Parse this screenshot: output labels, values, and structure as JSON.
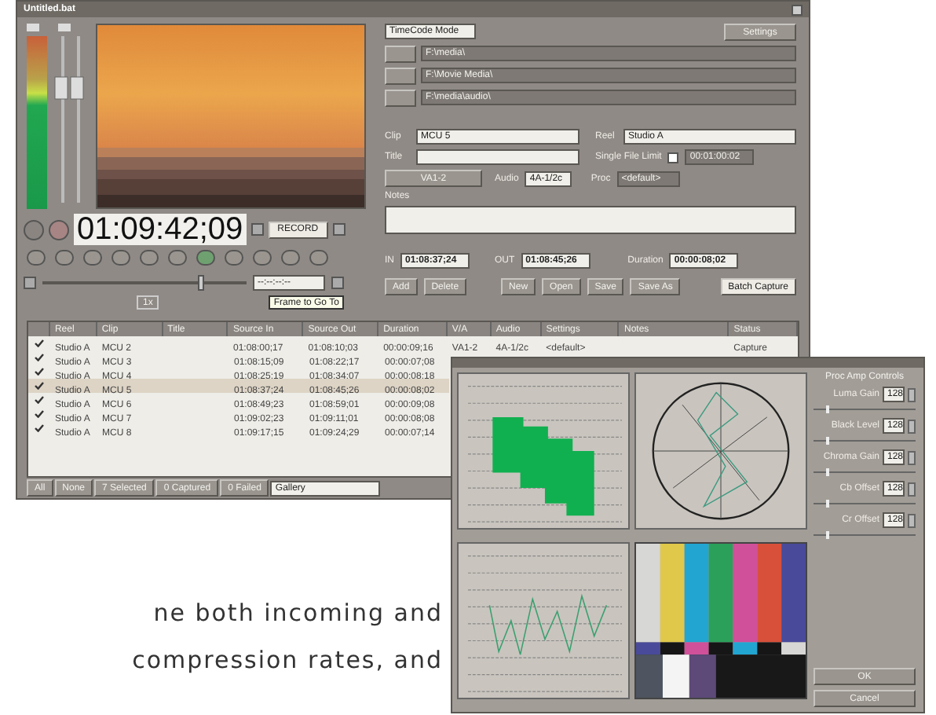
{
  "main_window": {
    "title": "Untitled.bat",
    "monitor": {
      "timecode": "01:09:42;09",
      "record_button": "RECORD",
      "frame_field": "--:--:--:--",
      "speed": "1x",
      "tooltip": "Frame to Go To",
      "shuttle": {
        "level": 0.78
      }
    },
    "mode_select": "TimeCode Mode",
    "settings_button": "Settings",
    "paths": [
      "F:\\media\\",
      "F:\\Movie Media\\",
      "F:\\media\\audio\\"
    ],
    "form": {
      "clip_label": "Clip",
      "clip": "MCU 5",
      "reel_label": "Reel",
      "reel": "Studio A",
      "title_label": "Title",
      "limit_label": "Single File Limit",
      "limit_checked": false,
      "limit": "00:01:00:02",
      "video_button": "VA1-2",
      "audio_label": "Audio",
      "audio": "4A-1/2c",
      "proc_label": "Proc",
      "proc": "<default>",
      "notes_label": "Notes"
    },
    "timecodes": {
      "in_label": "IN",
      "in": "01:08:37;24",
      "out_label": "OUT",
      "out": "01:08:45;26",
      "duration_label": "Duration",
      "duration": "00:00:08;02"
    },
    "buttons": [
      "Add",
      "Delete",
      "New",
      "Open",
      "Save",
      "Save As",
      "Batch Capture"
    ],
    "table": {
      "columns": [
        "Reel",
        "Clip",
        "Title",
        "Source In",
        "Source Out",
        "Duration",
        "V/A",
        "Audio",
        "Settings",
        "Notes",
        "Status"
      ],
      "rows": [
        {
          "checked": true,
          "selected": false,
          "cells": [
            "Studio A",
            "MCU 2",
            null,
            "01:08:00;17",
            "01:08:10;03",
            "00:00:09;16",
            "VA1-2",
            "4A-1/2c",
            "<default>",
            null,
            "Capture"
          ]
        },
        {
          "checked": true,
          "selected": false,
          "cells": [
            "Studio A",
            "MCU 3",
            null,
            "01:08:15;09",
            "01:08:22;17",
            "00:00:07;08"
          ]
        },
        {
          "checked": true,
          "selected": false,
          "cells": [
            "Studio A",
            "MCU 4",
            null,
            "01:08:25;19",
            "01:08:34;07",
            "00:00:08;18"
          ]
        },
        {
          "checked": true,
          "selected": true,
          "cells": [
            "Studio A",
            "MCU 5",
            null,
            "01:08:37;24",
            "01:08:45;26",
            "00:00:08;02"
          ]
        },
        {
          "checked": true,
          "selected": false,
          "cells": [
            "Studio A",
            "MCU 6",
            null,
            "01:08:49;23",
            "01:08:59;01",
            "00:00:09;08"
          ]
        },
        {
          "checked": true,
          "selected": false,
          "cells": [
            "Studio A",
            "MCU 7",
            null,
            "01:09:02;23",
            "01:09:11;01",
            "00:00:08;08"
          ]
        },
        {
          "checked": true,
          "selected": false,
          "cells": [
            "Studio A",
            "MCU 8",
            null,
            "01:09:17;15",
            "01:09:24;29",
            "00:00:07;14"
          ]
        }
      ]
    },
    "status_bar": {
      "buttons": [
        "All",
        "None",
        "7 Selected",
        "0 Captured",
        "0 Failed"
      ],
      "bin": "Gallery"
    }
  },
  "scope_window": {
    "proc_amp_title": "Proc Amp Controls",
    "controls": [
      {
        "label": "Luma Gain",
        "value": "128",
        "level": 0.12
      },
      {
        "label": "Black Level",
        "value": "128",
        "level": 0.12
      },
      {
        "label": "Chroma Gain",
        "value": "128",
        "level": 0.12
      },
      {
        "label": "Cb Offset",
        "value": "128",
        "level": 0.12
      },
      {
        "label": "Cr Offset",
        "value": "128",
        "level": 0.12
      }
    ],
    "buttons": [
      "OK",
      "Cancel"
    ]
  },
  "caption": [
    "ne both incoming and",
    "compression rates, and"
  ]
}
